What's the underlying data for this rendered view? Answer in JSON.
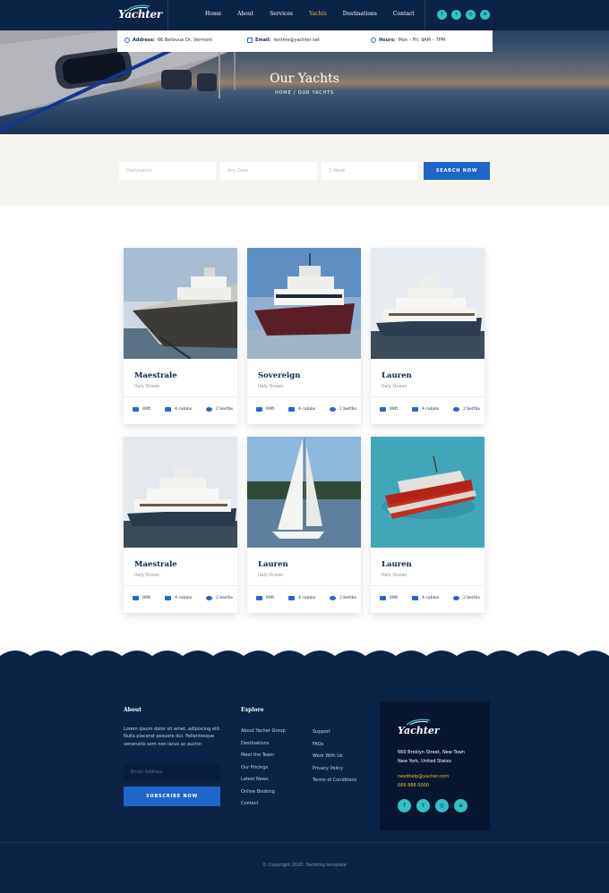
{
  "brand": {
    "name": "Yachter"
  },
  "nav": {
    "items": [
      "Home",
      "About",
      "Services",
      "Yachts",
      "Destinations",
      "Contact"
    ],
    "active": "Yachts"
  },
  "social": [
    "facebook-icon",
    "twitter-icon",
    "instagram-icon",
    "dribbble-icon"
  ],
  "info": {
    "address_label": "Address:",
    "address": "66 Bellevue Dr, Vermont",
    "email_label": "Email:",
    "email": "rentme@yachter.net",
    "hours_label": "Hours:",
    "hours": "Mon – Fri: 9AM – 7PM"
  },
  "hero": {
    "title": "Our Yachts",
    "breadcrumb": "HOME / OUR YACHTS"
  },
  "search": {
    "destination_placeholder": "Destination",
    "date_placeholder": "Any Date",
    "duration_placeholder": "1 Week",
    "button": "SEARCH NOW"
  },
  "yachts": [
    {
      "name": "Maestrale",
      "location": "Italy Ocean",
      "length": "89ft",
      "cabins": "4 cabins",
      "berths": "2 berths"
    },
    {
      "name": "Sovereign",
      "location": "Italy Ocean",
      "length": "89ft",
      "cabins": "4 cabins",
      "berths": "2 berths"
    },
    {
      "name": "Lauren",
      "location": "Italy Ocean",
      "length": "89ft",
      "cabins": "4 cabins",
      "berths": "2 berths"
    },
    {
      "name": "Maestrale",
      "location": "Italy Ocean",
      "length": "89ft",
      "cabins": "4 cabins",
      "berths": "2 berths"
    },
    {
      "name": "Lauren",
      "location": "Italy Ocean",
      "length": "89ft",
      "cabins": "4 cabins",
      "berths": "2 berths"
    },
    {
      "name": "Lauren",
      "location": "Italy Ocean",
      "length": "89ft",
      "cabins": "4 cabins",
      "berths": "2 berths"
    }
  ],
  "footer": {
    "about_title": "About",
    "about_text": "Lorem ipsum dolor sit amet, adipiscing elit. Nulla placerat posuere dui. Pellentesque venenatis sem non lacus ac auctor.",
    "email_placeholder": "Email Address",
    "subscribe": "SUBSCRIBE NOW",
    "explore_title": "Explore",
    "explore_col1": [
      "About Yacher Group",
      "Destinations",
      "Meet the Team",
      "Our Pricings",
      "Latest News",
      "Online Booking",
      "Contact"
    ],
    "explore_col2": [
      "Support",
      "FAQs",
      "Work With Us",
      "Privacy Policy",
      "Terms of Conditions"
    ],
    "contact": {
      "address_line1": "660 Broklyn Street, New Town",
      "address_line2": "New York, United States",
      "email": "needhelp@yacher.com",
      "phone": "666 888 0000"
    },
    "copyright": "© Copyright 2020. Yachting template"
  },
  "colors": {
    "navy": "#0c2348",
    "accent_blue": "#1e66c8",
    "teal": "#2fc1c6",
    "gold": "#e8c043"
  }
}
